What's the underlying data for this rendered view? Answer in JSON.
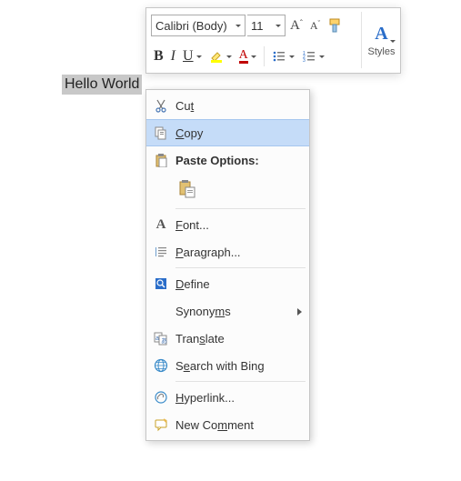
{
  "document": {
    "selected_text": "Hello World"
  },
  "mini_toolbar": {
    "font_name": "Calibri (Body)",
    "font_size": "11",
    "grow_font": "A",
    "shrink_font": "A",
    "bold": "B",
    "italic": "I",
    "underline": "U",
    "highlight": "ab",
    "font_color": "A",
    "styles_label": "Styles"
  },
  "context_menu": {
    "items": [
      {
        "label_pre": "Cu",
        "mn": "t",
        "label_post": "",
        "icon": "cut"
      },
      {
        "label_pre": "",
        "mn": "C",
        "label_post": "opy",
        "icon": "copy",
        "hover": true
      },
      {
        "label_pre": "",
        "mn": "",
        "label_post": "Paste Options:",
        "icon": "paste-options",
        "bold": true,
        "header": true
      },
      {
        "label_pre": "",
        "mn": "F",
        "label_post": "ont...",
        "icon": "font-a"
      },
      {
        "label_pre": "",
        "mn": "P",
        "label_post": "aragraph...",
        "icon": "paragraph"
      },
      {
        "label_pre": "",
        "mn": "D",
        "label_post": "efine",
        "icon": "define"
      },
      {
        "label_pre": "Synony",
        "mn": "m",
        "label_post": "s",
        "icon": "",
        "submenu": true
      },
      {
        "label_pre": "Tran",
        "mn": "s",
        "label_post": "late",
        "icon": "translate"
      },
      {
        "label_pre": "S",
        "mn": "e",
        "label_post": "arch with Bing",
        "icon": "search"
      },
      {
        "label_pre": "",
        "mn": "H",
        "label_post": "yperlink...",
        "icon": "hyperlink"
      },
      {
        "label_pre": "New Co",
        "mn": "m",
        "label_post": "ment",
        "icon": "comment"
      }
    ]
  }
}
